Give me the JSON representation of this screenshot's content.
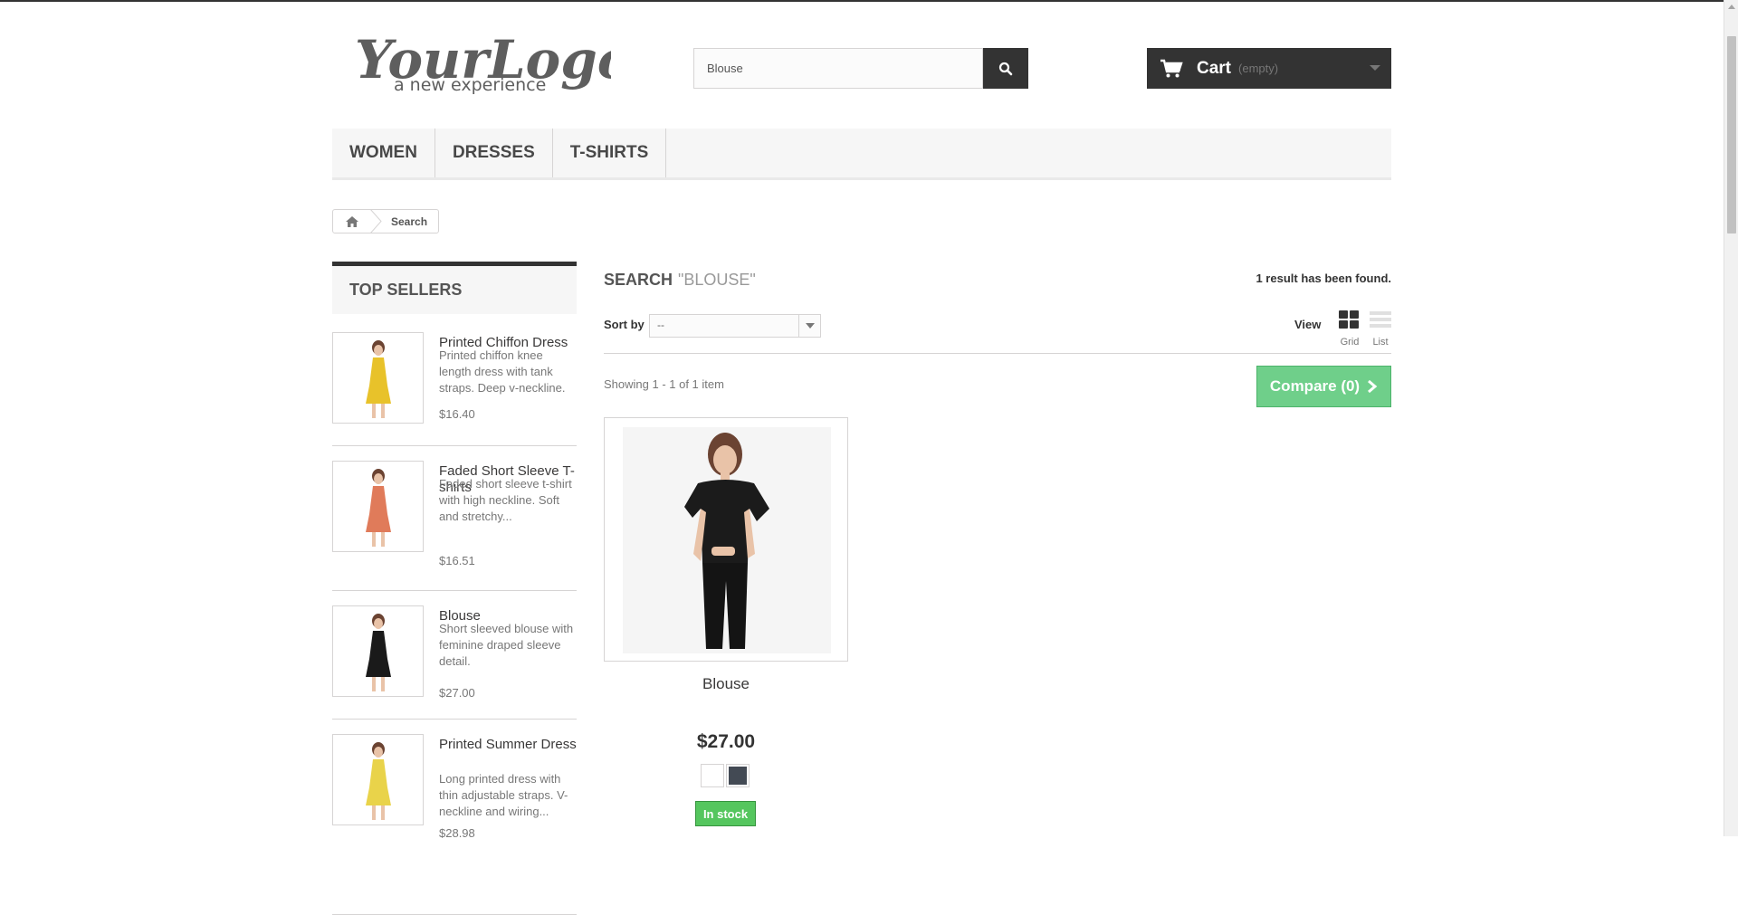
{
  "logo": {
    "line1": "YourLogo",
    "line2": "a new experience"
  },
  "search": {
    "value": "Blouse",
    "button_icon": "search-icon"
  },
  "cart": {
    "label": "Cart",
    "status": "(empty)",
    "icon": "cart-icon"
  },
  "menu": {
    "items": [
      {
        "label": "Women"
      },
      {
        "label": "Dresses"
      },
      {
        "label": "T-shirts"
      }
    ]
  },
  "breadcrumb": {
    "home_icon": "home-icon",
    "current": "Search"
  },
  "top_sellers": {
    "title": "Top sellers",
    "items": [
      {
        "name": "Printed Chiffon Dress",
        "description": "Printed chiffon knee length dress with tank straps. Deep v-neckline.",
        "price": "$16.40",
        "dress_color": "#e8c22a"
      },
      {
        "name": "Faded Short Sleeve T-shirts",
        "description": "Faded short sleeve t-shirt with high neckline. Soft and stretchy...",
        "price": "$16.51",
        "dress_color": "#e07b5a"
      },
      {
        "name": "Blouse",
        "description": "Short sleeved blouse with feminine draped sleeve detail.",
        "price": "$27.00",
        "dress_color": "#1a1a1a"
      },
      {
        "name": "Printed Summer Dress",
        "description": "Long printed dress with thin adjustable straps. V-neckline and wiring...",
        "price": "$28.98",
        "dress_color": "#e9d34a"
      }
    ]
  },
  "search_results": {
    "title": "Search",
    "query": "\"Blouse\"",
    "count_text": "1 result has been found.",
    "sort_label": "Sort by",
    "sort_value": "--",
    "view_label": "View",
    "view_grid": "Grid",
    "view_list": "List",
    "showing": "Showing 1 - 1 of 1 item",
    "compare_label": "Compare (0)"
  },
  "product": {
    "name": "Blouse",
    "price": "$27.00",
    "colors": [
      "#ffffff",
      "#434a54"
    ],
    "availability": "In stock"
  },
  "colors": {
    "dark": "#333333",
    "compare_green": "#6fcf8a",
    "stock_green": "#55c65e",
    "menu_bg": "#f6f6f6"
  }
}
